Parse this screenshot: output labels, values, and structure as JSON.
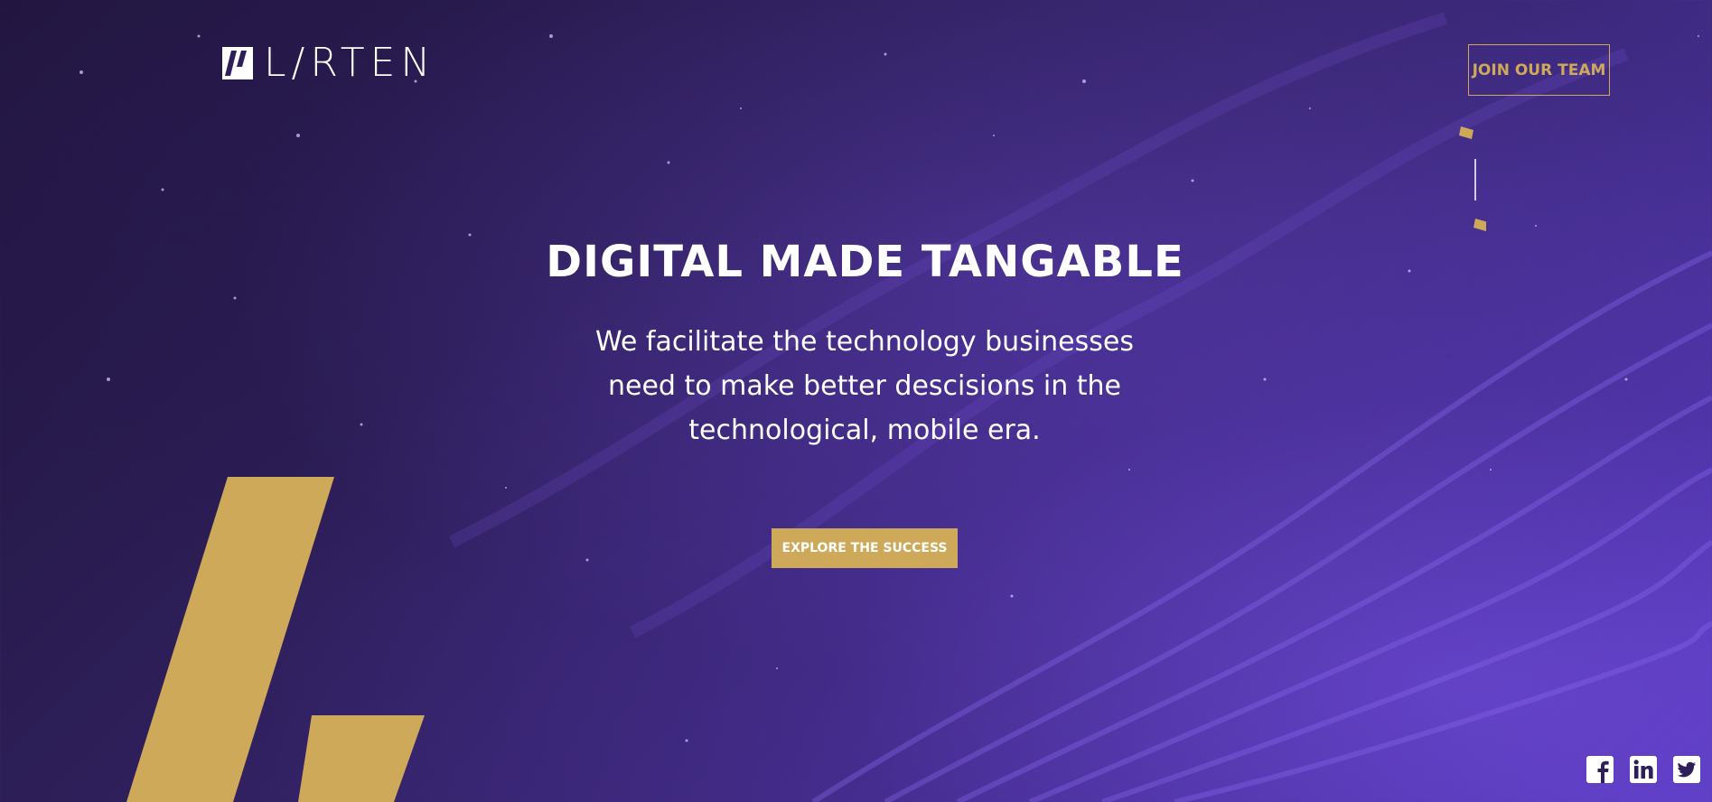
{
  "header": {
    "logo_text": "L/RTEN",
    "join_button": "JOIN OUR TEAM"
  },
  "hero": {
    "title": "DIGITAL MADE TANGABLE",
    "subtitle": "We facilitate the technology businesses need to make better descisions in the technological, mobile era.",
    "cta": "EXPLORE THE SUCCESS"
  },
  "social": [
    {
      "icon": "facebook-icon"
    },
    {
      "icon": "linkedin-icon"
    },
    {
      "icon": "twitter-icon"
    }
  ],
  "colors": {
    "accent": "#cfa95a",
    "background": "#2e1f5a",
    "text": "#ffffff"
  }
}
